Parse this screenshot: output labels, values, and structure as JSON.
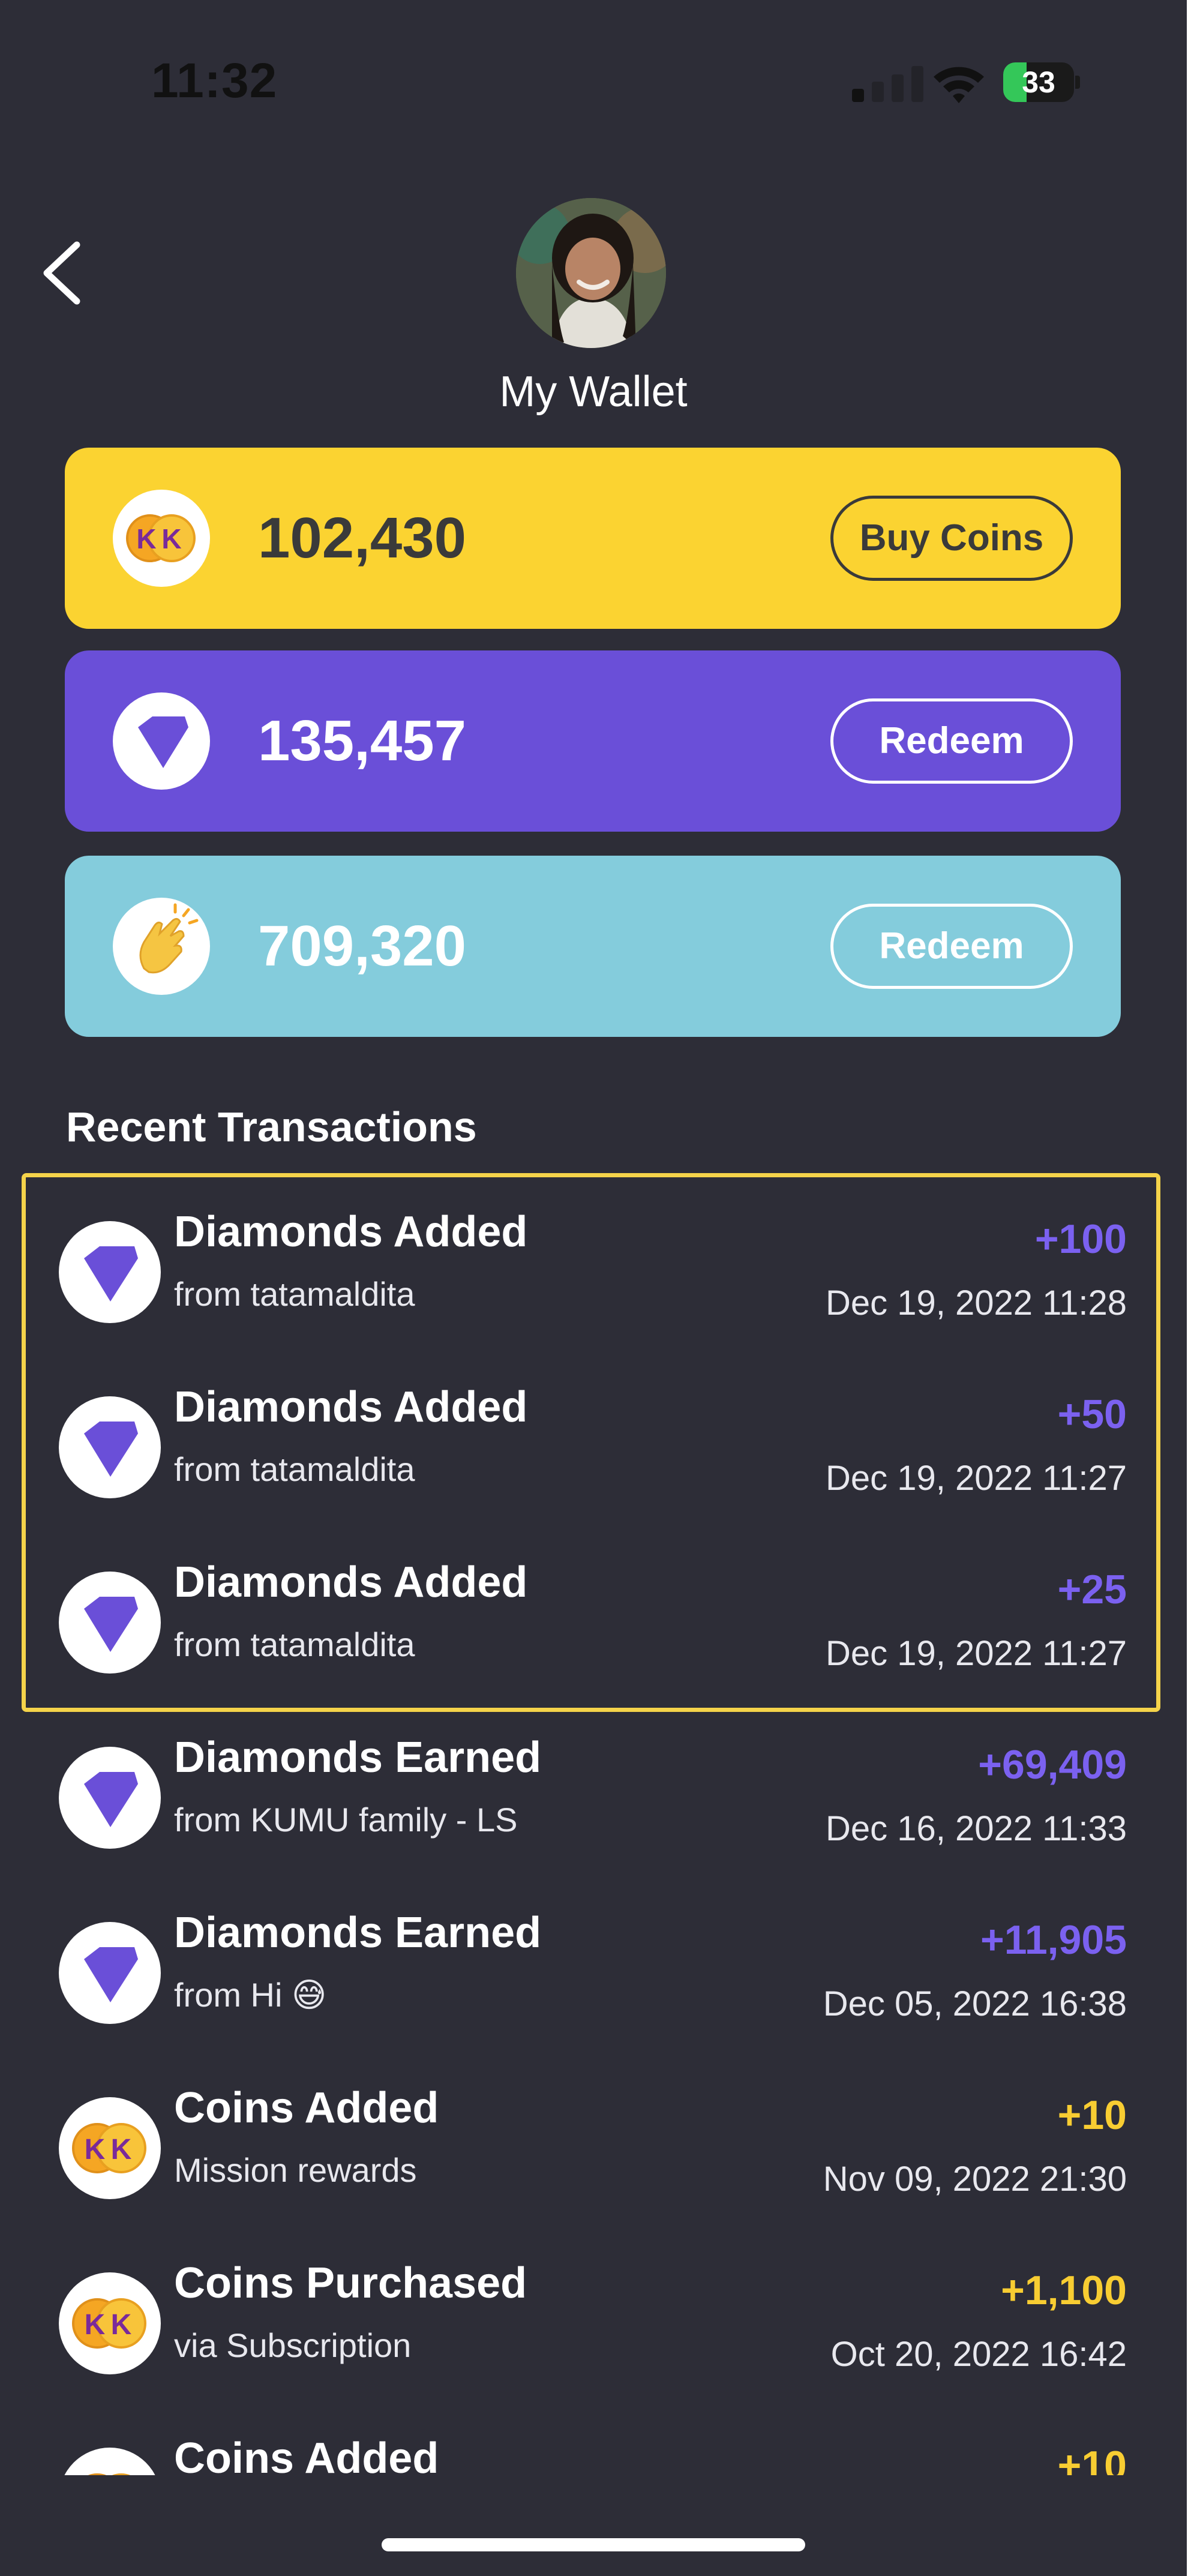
{
  "status_bar": {
    "time": "11:32",
    "battery": "33",
    "battery_level": 0.33
  },
  "header": {
    "title": "My Wallet"
  },
  "wallet": {
    "coins": {
      "value": "102,430",
      "button": "Buy Coins",
      "color": "#fbd331"
    },
    "diamonds": {
      "value": "135,457",
      "button": "Redeem",
      "color": "#6a4fd8"
    },
    "claps": {
      "value": "709,320",
      "button": "Redeem",
      "color": "#84ccdc"
    }
  },
  "recent": {
    "title": "Recent Transactions",
    "items": [
      {
        "title": "Diamonds Added",
        "sub": "from tatamaldita",
        "amount": "+100",
        "date": "Dec 19, 2022 11:28",
        "kind": "diamond"
      },
      {
        "title": "Diamonds Added",
        "sub": "from tatamaldita",
        "amount": "+50",
        "date": "Dec 19, 2022 11:27",
        "kind": "diamond"
      },
      {
        "title": "Diamonds Added",
        "sub": "from tatamaldita",
        "amount": "+25",
        "date": "Dec 19, 2022 11:27",
        "kind": "diamond"
      },
      {
        "title": "Diamonds Earned",
        "sub": "from KUMU family - LS",
        "amount": "+69,409",
        "date": "Dec 16, 2022 11:33",
        "kind": "diamond"
      },
      {
        "title": "Diamonds Earned",
        "sub": "from Hi 😅",
        "amount": "+11,905",
        "date": "Dec 05, 2022 16:38",
        "kind": "diamond"
      },
      {
        "title": "Coins Added",
        "sub": "Mission rewards",
        "amount": "+10",
        "date": "Nov 09, 2022 21:30",
        "kind": "coin"
      },
      {
        "title": "Coins Purchased",
        "sub": "via Subscription",
        "amount": "+1,100",
        "date": "Oct 20, 2022 16:42",
        "kind": "coin"
      },
      {
        "title": "Coins Added",
        "sub": "",
        "amount": "+10",
        "date": "",
        "kind": "coin"
      }
    ]
  },
  "colors": {
    "background": "#2d2d37",
    "diamond_amount": "#7b61f0",
    "coin_amount": "#f8cd32",
    "highlight": "#f5d34a"
  }
}
